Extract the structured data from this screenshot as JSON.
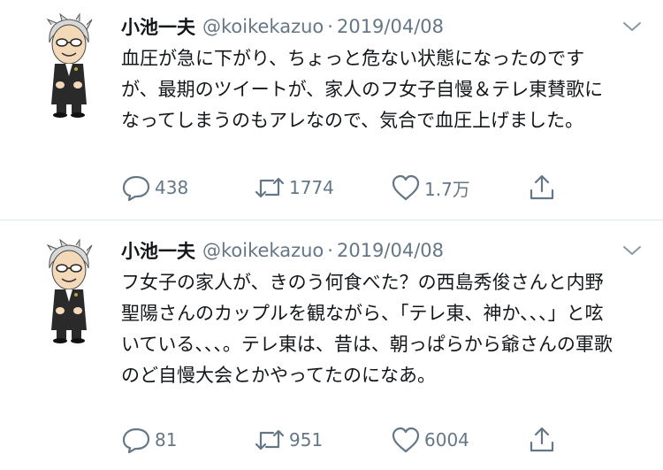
{
  "tweets": [
    {
      "display_name": "小池一夫",
      "handle": "@koikekazuo",
      "separator": "·",
      "date": "2019/04/08",
      "text": "血圧が急に下がり、ちょっと危ない状態になったのですが、最期のツイートが、家人のフ女子自慢＆テレ東賛歌になってしまうのもアレなので、気合で血圧上げました。",
      "replies": "438",
      "retweets": "1774",
      "likes": "1.7万"
    },
    {
      "display_name": "小池一夫",
      "handle": "@koikekazuo",
      "separator": "·",
      "date": "2019/04/08",
      "text": "フ女子の家人が、きのう何食べた？の西島秀俊さんと内野聖陽さんのカップルを観ながら、「テレ東、神か、、、」と呟いている、、、。テレ東は、昔は、朝っぱらから爺さんの軍歌のど自慢大会とかやってたのになあ。",
      "replies": "81",
      "retweets": "951",
      "likes": "6004"
    }
  ],
  "colors": {
    "text": "#14171a",
    "muted": "#657786",
    "divider": "#e1e8ed"
  },
  "icons": [
    "avatar-illustration",
    "chevron-down-icon",
    "reply-icon",
    "retweet-icon",
    "like-icon",
    "share-icon"
  ]
}
